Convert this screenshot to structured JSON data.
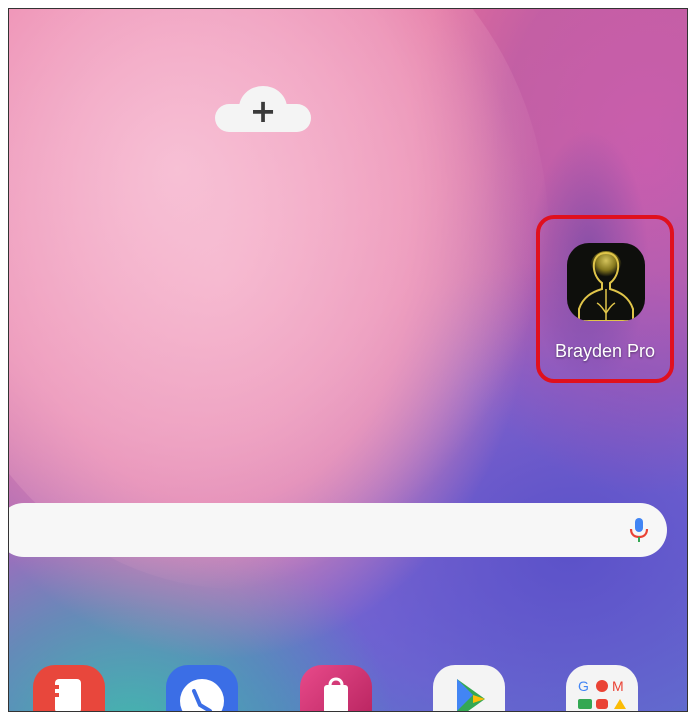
{
  "home_screen": {
    "add_widget_symbol": "+",
    "app_shortcut": {
      "label": "Brayden Pro",
      "icon": "brayden-pro-icon",
      "highlight_color": "#e0101e"
    },
    "search_bar": {
      "mic_icon": "microphone-icon"
    },
    "dock": [
      {
        "icon": "samsung-notes-icon",
        "color": "#e8473c"
      },
      {
        "icon": "phone-icon",
        "color": "#3b6ee6"
      },
      {
        "icon": "galaxy-store-icon",
        "color": "#d3306f"
      },
      {
        "icon": "play-store-icon",
        "color": "#f4f4f4"
      },
      {
        "icon": "google-folder-icon",
        "color": "#f4f4f4"
      }
    ]
  }
}
